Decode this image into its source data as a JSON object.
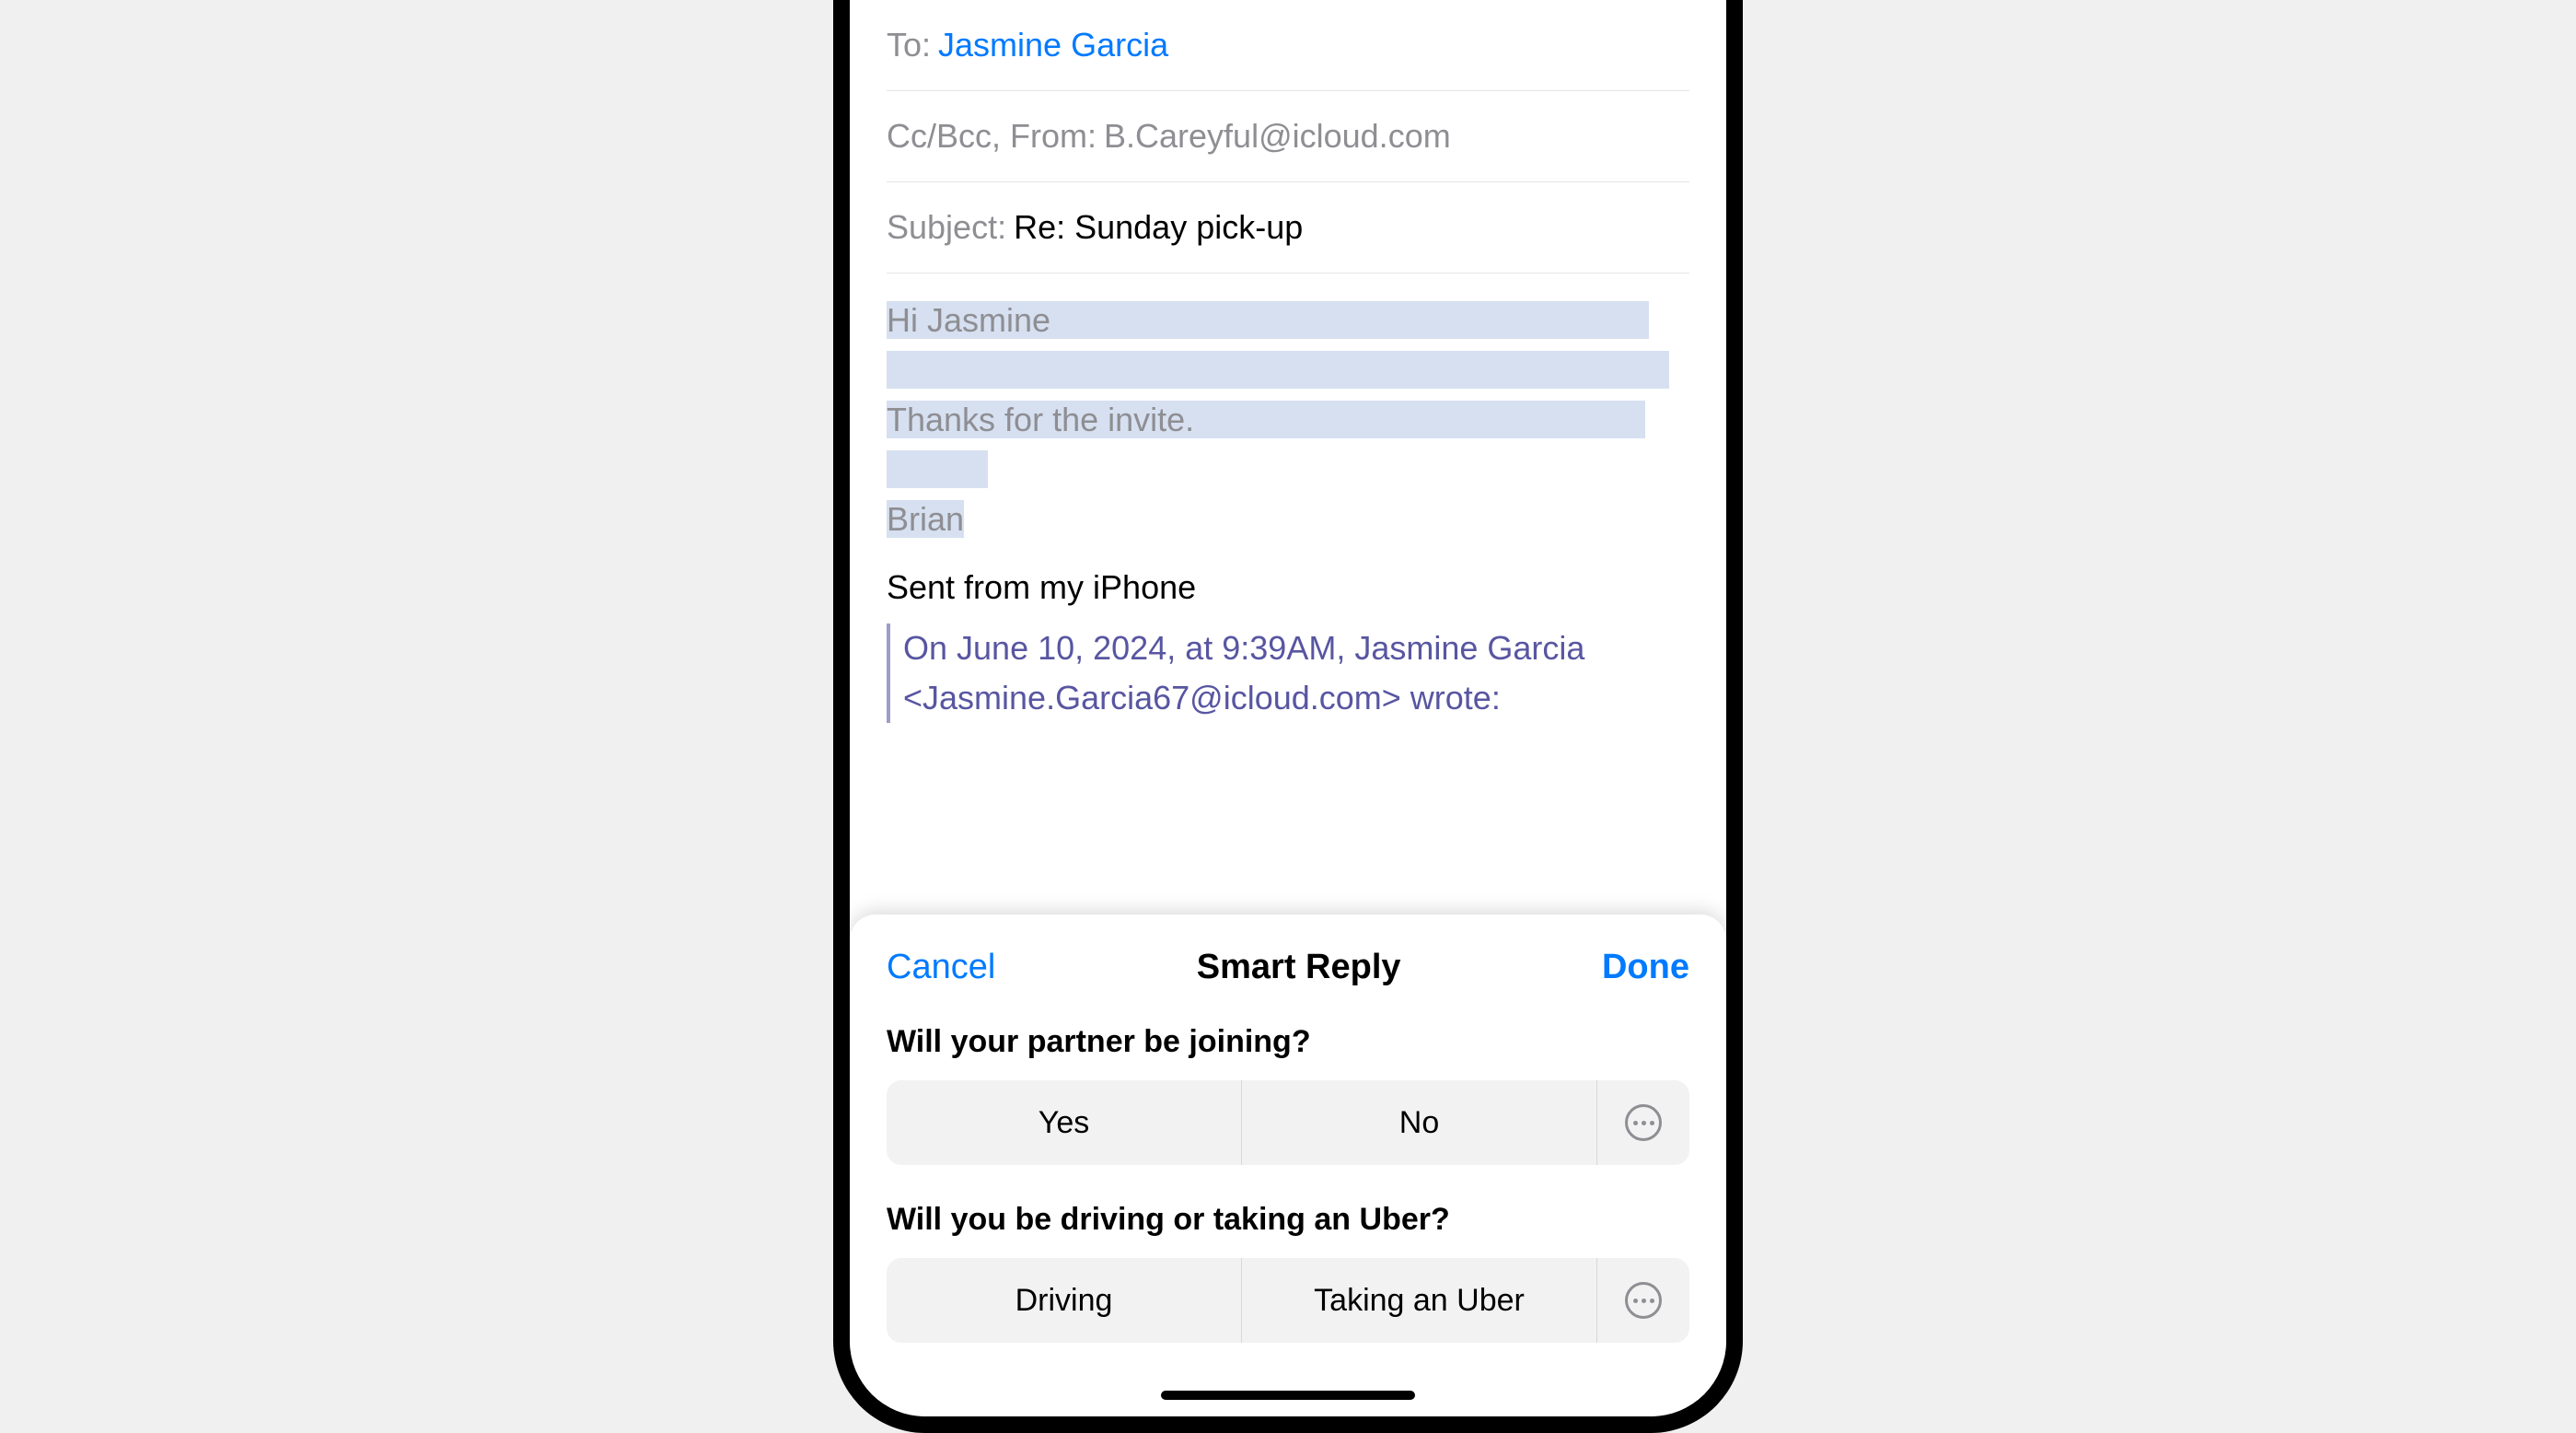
{
  "compose": {
    "to_label": "To:",
    "to_value": "Jasmine Garcia",
    "ccbcc_label": "Cc/Bcc, From:",
    "from_value": "B.Careyful@icloud.com",
    "subject_label": "Subject:",
    "subject_value": "Re: Sunday pick-up",
    "body_line1": "Hi Jasmine",
    "body_line2": "Thanks for the invite.",
    "body_line3": "Brian",
    "signature": "Sent from my iPhone",
    "quoted": "On June 10, 2024, at 9:39AM, Jasmine Garcia <Jasmine.Garcia67@icloud.com> wrote:"
  },
  "smartReply": {
    "cancel": "Cancel",
    "title": "Smart Reply",
    "done": "Done",
    "questions": [
      {
        "prompt": "Will your partner be joining?",
        "options": [
          "Yes",
          "No"
        ]
      },
      {
        "prompt": "Will you be driving or taking an Uber?",
        "options": [
          "Driving",
          "Taking an Uber"
        ]
      }
    ]
  }
}
